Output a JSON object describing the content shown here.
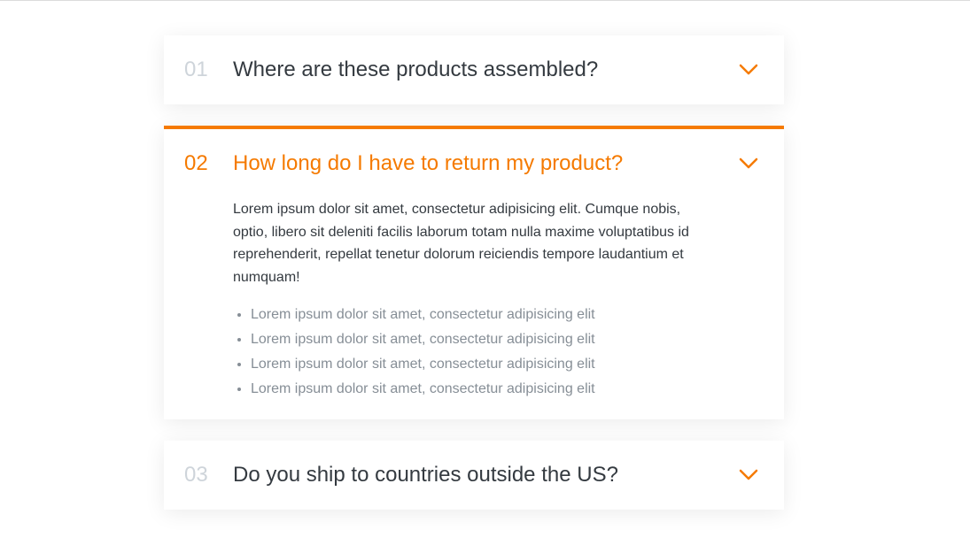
{
  "accent_color": "#f57a00",
  "faq": {
    "items": [
      {
        "number": "01",
        "question": "Where are these products assembled?",
        "expanded": false,
        "icon": "chevron-down-icon"
      },
      {
        "number": "02",
        "question": "How long do I have to return my product?",
        "expanded": true,
        "icon": "chevron-down-icon",
        "answer": {
          "paragraph": "Lorem ipsum dolor sit amet, consectetur adipisicing elit. Cumque nobis, optio, libero sit deleniti facilis laborum totam nulla maxime voluptatibus id reprehenderit, repellat tenetur dolorum reiciendis tempore laudantium et numquam!",
          "list": [
            "Lorem ipsum dolor sit amet, consectetur adipisicing elit",
            "Lorem ipsum dolor sit amet, consectetur adipisicing elit",
            "Lorem ipsum dolor sit amet, consectetur adipisicing elit",
            "Lorem ipsum dolor sit amet, consectetur adipisicing elit"
          ]
        }
      },
      {
        "number": "03",
        "question": "Do you ship to countries outside the US?",
        "expanded": false,
        "icon": "chevron-down-icon"
      }
    ]
  }
}
